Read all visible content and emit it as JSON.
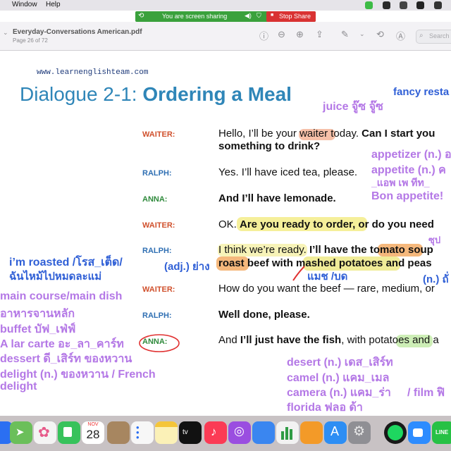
{
  "menubar": {
    "window": "Window",
    "help": "Help"
  },
  "sharebar": {
    "sharing": "You are screen sharing",
    "stop": "Stop Share"
  },
  "toolbar": {
    "title": "Everyday-Conversations American.pdf",
    "page": "Page 26 of 72",
    "search_placeholder": "Search"
  },
  "doc": {
    "url": "www.learnenglishteam.com",
    "title_light": "Dialogue 2-1: ",
    "title_bold": "Ordering a Meal",
    "lines": [
      {
        "speaker": "WAITER:",
        "color": "#d0502c",
        "parts": [
          "Hello, I’ll be your ",
          "waiter",
          " today. ",
          "Can I start you"
        ]
      },
      {
        "speaker": "",
        "parts": [
          "something to drink?"
        ]
      },
      {
        "speaker": "RALPH:",
        "color": "#2f6fb3",
        "parts": [
          "Yes. I’ll have iced tea, please."
        ]
      },
      {
        "speaker": "ANNA:",
        "color": "#2f8a3c",
        "parts": [
          "And I’ll have lemonade."
        ]
      },
      {
        "speaker": "WAITER:",
        "color": "#d0502c",
        "parts": [
          "OK. ",
          "Are you ready to order,",
          " or do you need"
        ]
      },
      {
        "speaker": "RALPH:",
        "color": "#2f6fb3",
        "parts": [
          "I think we’re ready. ",
          "I’ll have the ",
          "tomato",
          " soup"
        ]
      },
      {
        "speaker": "",
        "parts": [
          "roast",
          " beef with ",
          "mashed potatoes",
          " and peas"
        ]
      },
      {
        "speaker": "WAITER:",
        "color": "#d0502c",
        "parts": [
          "How do you want the beef — rare, medium, or"
        ]
      },
      {
        "speaker": "RALPH:",
        "color": "#2f6fb3",
        "parts": [
          "Well done, please."
        ]
      },
      {
        "speaker": "ANNA:",
        "color": "#2f8a3c",
        "parts": [
          "And ",
          "I’ll just have the fish",
          ", with ",
          "potatoes",
          " and a"
        ]
      }
    ]
  },
  "notes": {
    "fancy": "fancy resta",
    "juice": "juice จู๊ซ จู๊ซ",
    "appetizer": "appetizer (n.) อ",
    "appetite": "appetite (n.) ค",
    "pron": "_แอพ เพ ทีท_",
    "bon": "Bon appetite!",
    "soup": "ซุป",
    "roasted1": "i’m roasted /โรส_เต็ด/",
    "roasted2": "ฉันไหม้ไปหมดละแม่",
    "adj": "(adj.) ย่าง",
    "mash": "แมช /บด",
    "n_thai": "(n.) ถั่",
    "main1": "main course/main dish",
    "main2": "อาหารจานหลัก",
    "buffet": "buffet บัฟ_เฟ่ฟ์",
    "alacarte": "A lar carte อะ_ลา_คาร์ท",
    "dessert": "dessert ดี_เสิร์ท ของหวาน",
    "delight": "delight (n.) ของหวาน / French",
    "delight2": "delight",
    "desert": "desert (n.) เดส_เสิร์ท",
    "camel": "camel (n.) แคม_เมล",
    "camera": "camera (n.) แคม_ร่า",
    "film": "/ film ฟิ",
    "florida": "florida ฟลอ  ด้า"
  },
  "dock": {
    "calendar_month": "NOV",
    "calendar_day": "28"
  }
}
